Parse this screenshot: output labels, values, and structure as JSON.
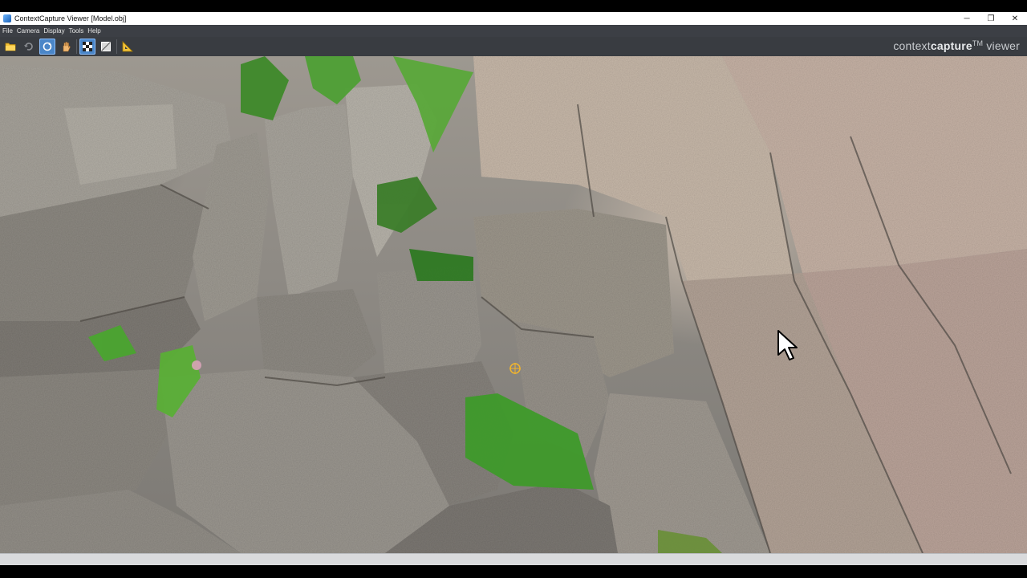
{
  "window": {
    "title": "ContextCapture Viewer [Model.obj]",
    "controls": {
      "minimize": "─",
      "maximize": "❐",
      "close": "✕"
    }
  },
  "menu": {
    "items": [
      "File",
      "Camera",
      "Display",
      "Tools",
      "Help"
    ]
  },
  "toolbar": {
    "tools": [
      {
        "icon": "open-folder-icon",
        "active": false
      },
      {
        "icon": "undo-view-icon",
        "active": false
      },
      {
        "icon": "orbit-icon",
        "active": true
      },
      {
        "icon": "pan-hand-icon",
        "active": false
      },
      {
        "icon": "textured-mode-icon",
        "active": true
      },
      {
        "icon": "wireframe-mode-icon",
        "active": false
      },
      {
        "icon": "measure-icon",
        "active": false
      }
    ]
  },
  "brand": {
    "part1": "context",
    "part2": "capture",
    "tm": "TM",
    "part3": " viewer"
  },
  "colors": {
    "menubar": "#3c3f45",
    "toolbar": "#393c41",
    "active_tool": "#4a86c8",
    "vegetation": "#3f8a2a",
    "rock": "#9a958d"
  }
}
